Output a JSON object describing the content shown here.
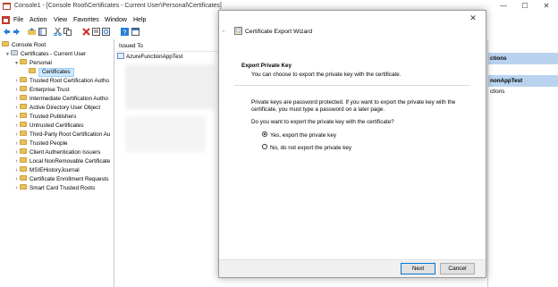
{
  "window": {
    "title": "Console1 - [Console Root\\Certificates - Current User\\Personal\\Certificates]",
    "min_glyph": "—",
    "max_glyph": "☐",
    "close_glyph": "✕"
  },
  "menu": {
    "items": [
      "File",
      "Action",
      "View",
      "Favorites",
      "Window",
      "Help"
    ]
  },
  "toolbar": {
    "icons": [
      "back-icon",
      "forward-icon",
      "up-folder-icon",
      "show-tree-icon",
      "cut-icon",
      "copy-icon",
      "delete-icon",
      "properties-icon",
      "refresh-icon",
      "export-list-icon",
      "help-icon",
      "console-icon"
    ]
  },
  "tree": {
    "root": "Console Root",
    "store": "Certificates - Current User",
    "personal": "Personal",
    "selected": "Certificates",
    "folders": [
      "Trusted Root Certification Autho",
      "Enterprise Trust",
      "Intermediate Certification Autho",
      "Active Directory User Object",
      "Trusted Publishers",
      "Untrusted Certificates",
      "Third-Party Root Certification Au",
      "Trusted People",
      "Client Authentication Issuers",
      "Local NonRemovable Certificate",
      "MSIEHistoryJournal",
      "Certificate Enrollment Requests",
      "Smart Card Trusted Roots"
    ]
  },
  "list": {
    "column_header": "Issued To",
    "rows": [
      "AzureFunctionAppTest"
    ]
  },
  "actions": {
    "items": [
      {
        "text": "ctions",
        "kind": "header"
      },
      {
        "text": "nonAppTest",
        "kind": "header"
      },
      {
        "text": "ctions",
        "kind": "item"
      }
    ]
  },
  "dialog": {
    "back_glyph": "←",
    "close_glyph": "✕",
    "title": "Certificate Export Wizard",
    "step_title": "Export Private Key",
    "step_description": "You can choose to export the private key with the certificate.",
    "body_line1": "Private keys are password protected. If you want to export the private key with the",
    "body_line2": "certificate, you must type a password on a later page.",
    "question": "Do you want to export the private key with the certificate?",
    "options": [
      {
        "label": "Yes, export the private key",
        "selected": true
      },
      {
        "label": "No, do not export the private key",
        "selected": false
      }
    ],
    "next_label": "Next",
    "cancel_label": "Cancel"
  },
  "colors": {
    "accent": "#0078d7",
    "selection": "#cce8ff",
    "actions_header": "#b9d3ef",
    "folder": "#e8c15a"
  }
}
